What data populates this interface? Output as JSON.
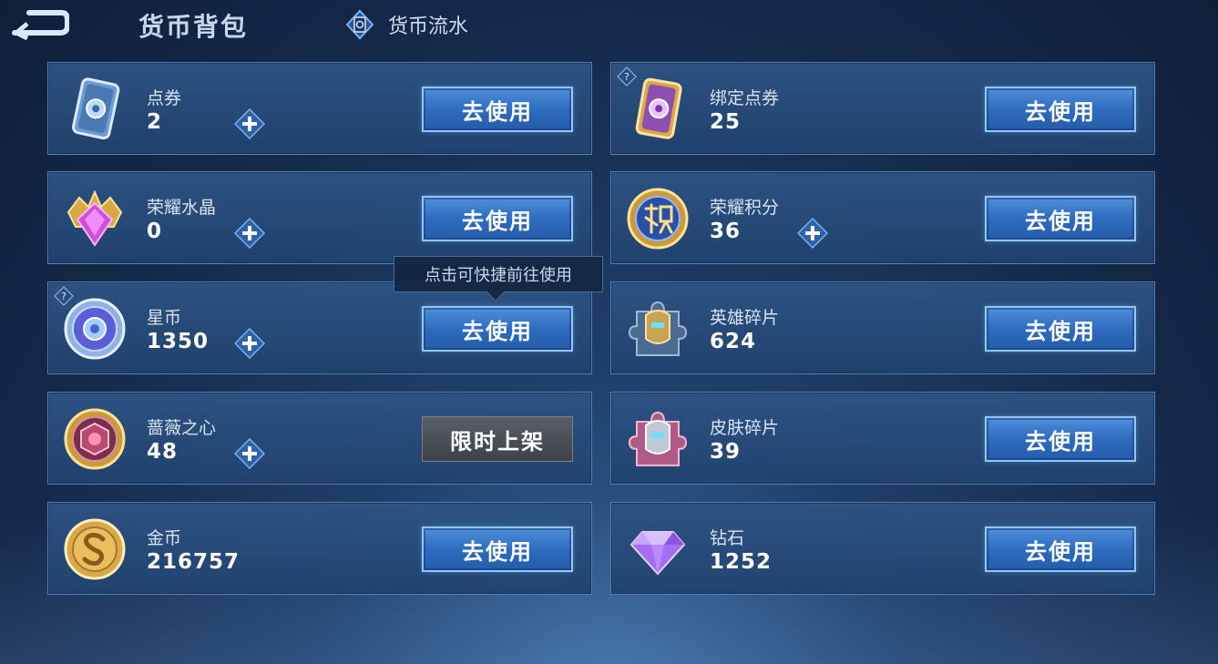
{
  "header": {
    "title": "货币背包",
    "flow_tab_label": "货币流水"
  },
  "tooltip": "点击可快捷前往使用",
  "currencies": [
    {
      "name": "点券",
      "amount": "2",
      "button": "去使用",
      "icon": "coupon-card-icon"
    },
    {
      "name": "绑定点券",
      "amount": "25",
      "button": "去使用",
      "icon": "bound-coupon-card-icon"
    },
    {
      "name": "荣耀水晶",
      "amount": "0",
      "button": "去使用",
      "icon": "glory-crystal-icon"
    },
    {
      "name": "荣耀积分",
      "amount": "36",
      "button": "去使用",
      "icon": "glory-points-icon"
    },
    {
      "name": "星币",
      "amount": "1350",
      "button": "去使用",
      "icon": "star-coin-icon"
    },
    {
      "name": "英雄碎片",
      "amount": "624",
      "button": "去使用",
      "icon": "hero-shard-icon"
    },
    {
      "name": "蔷薇之心",
      "amount": "48",
      "button": "限时上架",
      "icon": "rose-heart-icon"
    },
    {
      "name": "皮肤碎片",
      "amount": "39",
      "button": "去使用",
      "icon": "skin-shard-icon"
    },
    {
      "name": "金币",
      "amount": "216757",
      "button": "去使用",
      "icon": "gold-coin-icon"
    },
    {
      "name": "钻石",
      "amount": "1252",
      "button": "去使用",
      "icon": "diamond-icon"
    }
  ],
  "help_mark": "?",
  "colors": {
    "accent": "#2e6cc0",
    "panel": "#21426e",
    "background": "#15294a"
  }
}
